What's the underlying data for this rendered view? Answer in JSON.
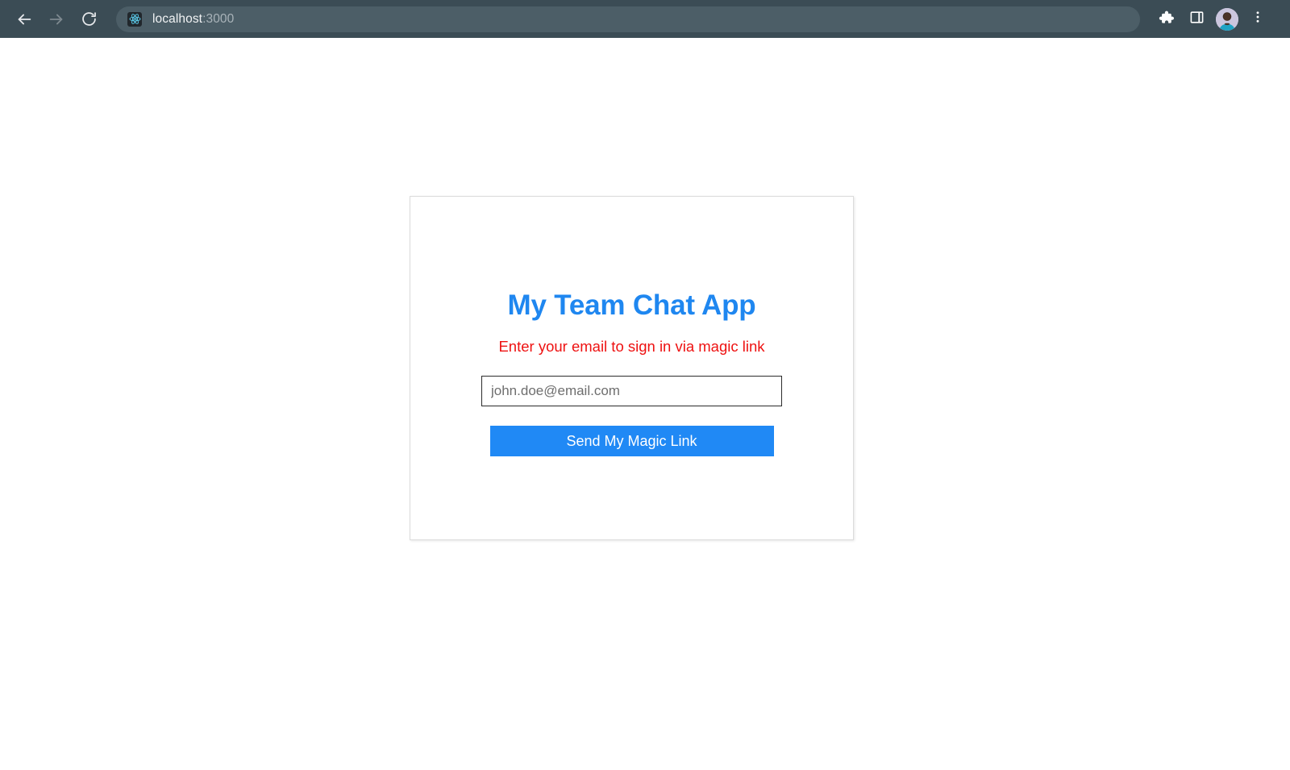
{
  "browser": {
    "back_label": "Back",
    "forward_label": "Forward",
    "reload_label": "Reload",
    "favicon_name": "react-logo-icon",
    "url_host": "localhost",
    "url_port": ":3000",
    "url_full": "localhost:3000",
    "extensions_label": "Extensions",
    "side_panel_label": "Side panel",
    "profile_label": "Profile",
    "menu_label": "Customize and control Google Chrome",
    "toolbar_color": "#3b4c55",
    "omnibox_color": "#4c5e67"
  },
  "card": {
    "title": "My Team Chat App",
    "title_color": "#1f87f0",
    "subtitle": "Enter your email to sign in via magic link",
    "subtitle_color": "#ee1111",
    "email": {
      "value": "",
      "placeholder": "john.doe@email.com"
    },
    "submit_label": "Send My Magic Link",
    "submit_color": "#2089f5"
  }
}
